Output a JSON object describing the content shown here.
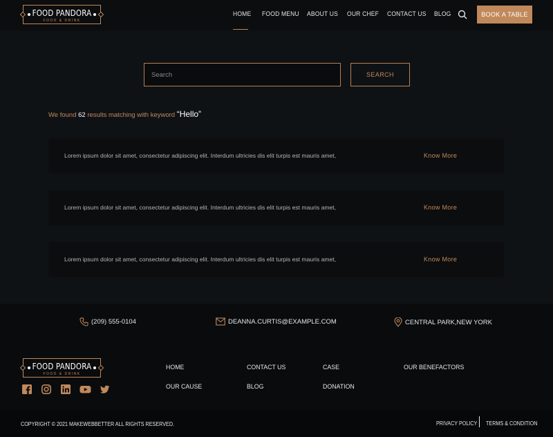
{
  "brand": {
    "name": "FOOD PANDORA",
    "tagline": "FOOD & DRINK"
  },
  "nav": {
    "items": [
      {
        "label": "HOME",
        "active": true
      },
      {
        "label": "FOOD MENU"
      },
      {
        "label": "ABOUT US"
      },
      {
        "label": "OUR CHEF"
      },
      {
        "label": "CONTACT US"
      },
      {
        "label": "BLOG"
      }
    ],
    "book_label": "BOOK A TABLE"
  },
  "search": {
    "placeholder": "Search",
    "value": "",
    "button_label": "SEARCH"
  },
  "results": {
    "prefix": "We found",
    "count": "62",
    "middle": "results matching with keyword",
    "keyword": "“Hello”"
  },
  "cards": [
    {
      "text": "Lorem ipsum dolor sit amet, consectetur adipiscing elit. Interdum ultricies dis elit turpis est mauris amet,",
      "link": "Know More"
    },
    {
      "text": "Lorem ipsum dolor sit amet, consectetur adipiscing elit. Interdum ultricies dis elit turpis est mauris amet,",
      "link": "Know More"
    },
    {
      "text": "Lorem ipsum dolor sit amet, consectetur adipiscing elit. Interdum ultricies dis elit turpis est mauris amet,",
      "link": "Know More"
    }
  ],
  "footer": {
    "contacts": {
      "phone": "(209) 555-0104",
      "email": "DEANNA.CURTIS@EXAMPLE.COM",
      "address": "CENTRAL PARK,NEW YORK"
    },
    "links": [
      "HOME",
      "CONTACT US",
      "CASE",
      "OUR BENEFACTORS",
      "OUR CAUSE",
      "BLOG",
      "DONATION"
    ],
    "social": [
      "facebook-icon",
      "instagram-icon",
      "linkedin-icon",
      "youtube-icon",
      "twitter-icon"
    ],
    "copyright": "COPYRIGHT © 2021 MAKEWEBBETTER ALL RIGHTS RESERVED.",
    "legal": {
      "privacy": "PRIVACY POLICY",
      "terms": "TERMS & CONDITION"
    }
  },
  "colors": {
    "accent": "#c1895b",
    "background": "#0f1215",
    "surface": "#0b0d0f"
  }
}
